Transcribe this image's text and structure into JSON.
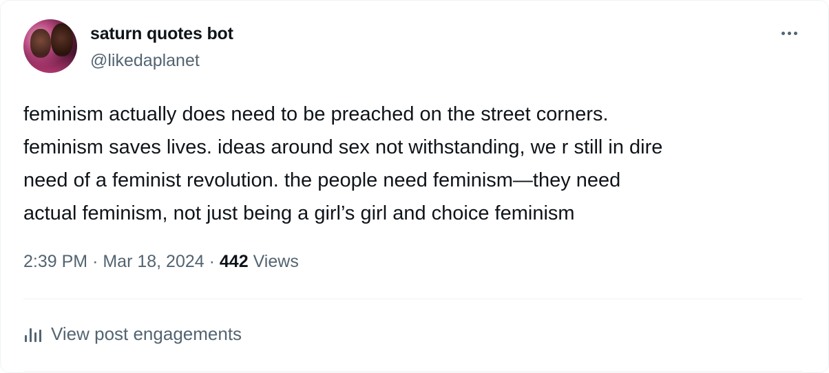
{
  "user": {
    "name": "saturn quotes bot",
    "handle": "@likedaplanet"
  },
  "tweet": {
    "lines": [
      "feminism actually does need to be preached on the street corners.",
      "feminism saves lives. ideas around sex not withstanding, we r still in dire",
      "need of a feminist revolution. the people need feminism—they need",
      "actual feminism, not just being a girl’s girl and choice feminism"
    ]
  },
  "meta": {
    "time": "2:39 PM",
    "separator": "·",
    "date": "Mar 18, 2024",
    "views_count": "442",
    "views_label": "Views"
  },
  "engagements": {
    "icon": "analytics-bar-icon",
    "label": "View post engagements"
  },
  "more_icon": "more-options-icon",
  "colors": {
    "primary_text": "#0f1419",
    "secondary_text": "#536471",
    "divider": "#eff3f4"
  }
}
